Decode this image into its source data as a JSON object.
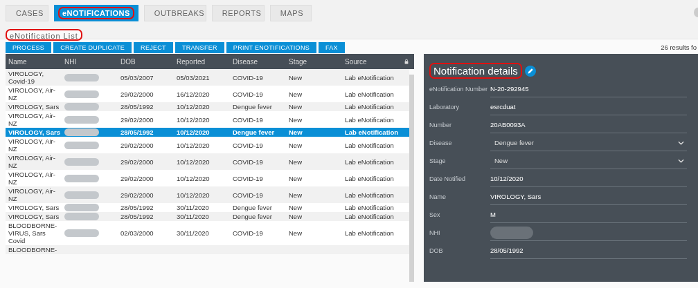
{
  "nav_tabs": [
    {
      "label": "CASES",
      "selected": false,
      "highlighted": false
    },
    {
      "label": "eNOTIFICATIONS",
      "selected": true,
      "highlighted": true
    },
    {
      "label": "OUTBREAKS",
      "selected": false,
      "highlighted": false
    },
    {
      "label": "REPORTS",
      "selected": false,
      "highlighted": false
    },
    {
      "label": "MAPS",
      "selected": false,
      "highlighted": false
    }
  ],
  "list_tab": {
    "label": "eNotification List",
    "highlighted": true
  },
  "actions": [
    "PROCESS",
    "CREATE DUPLICATE",
    "REJECT",
    "TRANSFER",
    "PRINT ENOTIFICATIONS",
    "FAX"
  ],
  "results": "26 results fo",
  "table": {
    "columns": [
      "Name",
      "NHI",
      "DOB",
      "Reported",
      "Disease",
      "Stage",
      "Source"
    ],
    "rows": [
      {
        "name": "VIROLOGY, Covid-19",
        "dob": "05/03/2007",
        "reported": "05/03/2021",
        "disease": "COVID-19",
        "stage": "New",
        "source": "Lab eNotification",
        "selected": false
      },
      {
        "name": "VIROLOGY, Air-NZ",
        "dob": "29/02/2000",
        "reported": "16/12/2020",
        "disease": "COVID-19",
        "stage": "New",
        "source": "Lab eNotification",
        "selected": false
      },
      {
        "name": "VIROLOGY, Sars",
        "dob": "28/05/1992",
        "reported": "10/12/2020",
        "disease": "Dengue fever",
        "stage": "New",
        "source": "Lab eNotification",
        "selected": false
      },
      {
        "name": "VIROLOGY, Air-NZ",
        "dob": "29/02/2000",
        "reported": "10/12/2020",
        "disease": "COVID-19",
        "stage": "New",
        "source": "Lab eNotification",
        "selected": false
      },
      {
        "name": "VIROLOGY, Sars",
        "dob": "28/05/1992",
        "reported": "10/12/2020",
        "disease": "Dengue fever",
        "stage": "New",
        "source": "Lab eNotification",
        "selected": true
      },
      {
        "name": "VIROLOGY, Air-NZ",
        "dob": "29/02/2000",
        "reported": "10/12/2020",
        "disease": "COVID-19",
        "stage": "New",
        "source": "Lab eNotification",
        "selected": false
      },
      {
        "name": "VIROLOGY, Air-NZ",
        "dob": "29/02/2000",
        "reported": "10/12/2020",
        "disease": "COVID-19",
        "stage": "New",
        "source": "Lab eNotification",
        "selected": false
      },
      {
        "name": "VIROLOGY, Air-NZ",
        "dob": "29/02/2000",
        "reported": "10/12/2020",
        "disease": "COVID-19",
        "stage": "New",
        "source": "Lab eNotification",
        "selected": false
      },
      {
        "name": "VIROLOGY, Air-NZ",
        "dob": "29/02/2000",
        "reported": "10/12/2020",
        "disease": "COVID-19",
        "stage": "New",
        "source": "Lab eNotification",
        "selected": false
      },
      {
        "name": "VIROLOGY, Sars",
        "dob": "28/05/1992",
        "reported": "30/11/2020",
        "disease": "Dengue fever",
        "stage": "New",
        "source": "Lab eNotification",
        "selected": false
      },
      {
        "name": "VIROLOGY, Sars",
        "dob": "28/05/1992",
        "reported": "30/11/2020",
        "disease": "Dengue fever",
        "stage": "New",
        "source": "Lab eNotification",
        "selected": false
      },
      {
        "name": "BLOODBORNE-VIRUS, Sars Covid",
        "dob": "02/03/2000",
        "reported": "30/11/2020",
        "disease": "COVID-19",
        "stage": "New",
        "source": "Lab eNotification",
        "selected": false
      },
      {
        "name": "BLOODBORNE-",
        "selected": false
      }
    ]
  },
  "details": {
    "title": "Notification details",
    "highlighted": true,
    "fields": [
      {
        "label": "eNotification Number",
        "value": "N-20-292945",
        "kind": "text"
      },
      {
        "label": "Laboratory",
        "value": "esrcduat",
        "kind": "text"
      },
      {
        "label": "Number",
        "value": "20AB0093A",
        "kind": "text"
      },
      {
        "label": "Disease",
        "value": "Dengue fever",
        "kind": "select"
      },
      {
        "label": "Stage",
        "value": "New",
        "kind": "select"
      },
      {
        "label": "Date Notified",
        "value": "10/12/2020",
        "kind": "text"
      },
      {
        "label": "Name",
        "value": "VIROLOGY, Sars",
        "kind": "text"
      },
      {
        "label": "Sex",
        "value": "M",
        "kind": "text"
      },
      {
        "label": "NHI",
        "kind": "redacted"
      },
      {
        "label": "DOB",
        "value": "28/05/1992",
        "kind": "text"
      }
    ]
  }
}
